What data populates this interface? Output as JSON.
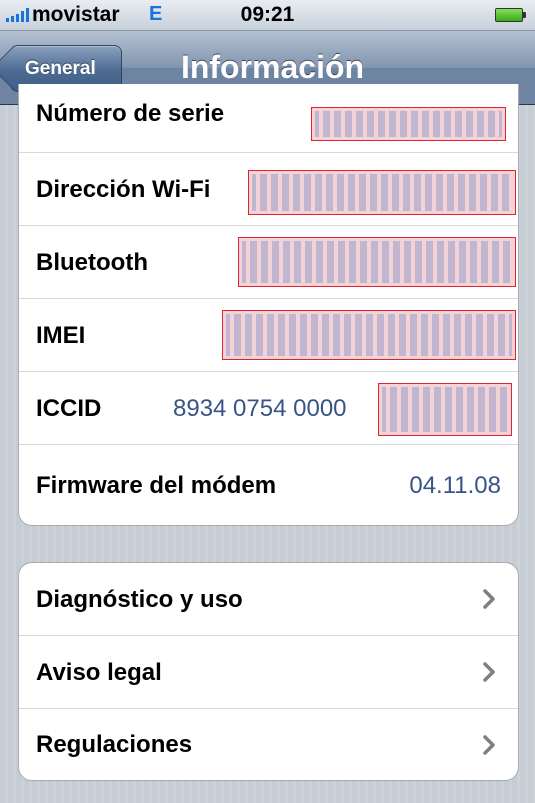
{
  "status_bar": {
    "carrier": "movistar",
    "network": "E",
    "time": "09:21",
    "signal_bars": 5,
    "battery_level": 1.0
  },
  "nav": {
    "back_label": "General",
    "title": "Información"
  },
  "info_rows": [
    {
      "label": "Número de serie",
      "value": "",
      "redacted": true
    },
    {
      "label": "Dirección Wi-Fi",
      "value": "",
      "redacted": true
    },
    {
      "label": "Bluetooth",
      "value": "",
      "redacted": true
    },
    {
      "label": "IMEI",
      "value": "",
      "redacted": true
    },
    {
      "label": "ICCID",
      "value": "8934 0754 0000",
      "redacted": true
    },
    {
      "label": "Firmware del módem",
      "value": "04.11.08",
      "redacted": false
    }
  ],
  "link_rows": [
    {
      "label": "Diagnóstico y uso"
    },
    {
      "label": "Aviso legal"
    },
    {
      "label": "Regulaciones"
    }
  ],
  "colors": {
    "value_text": "#385487",
    "redaction_border": "#e0242d",
    "signal": "#1a73d8"
  },
  "icons": [
    "signal-bars-icon",
    "battery-icon",
    "back-arrow-icon",
    "chevron-right-icon"
  ]
}
